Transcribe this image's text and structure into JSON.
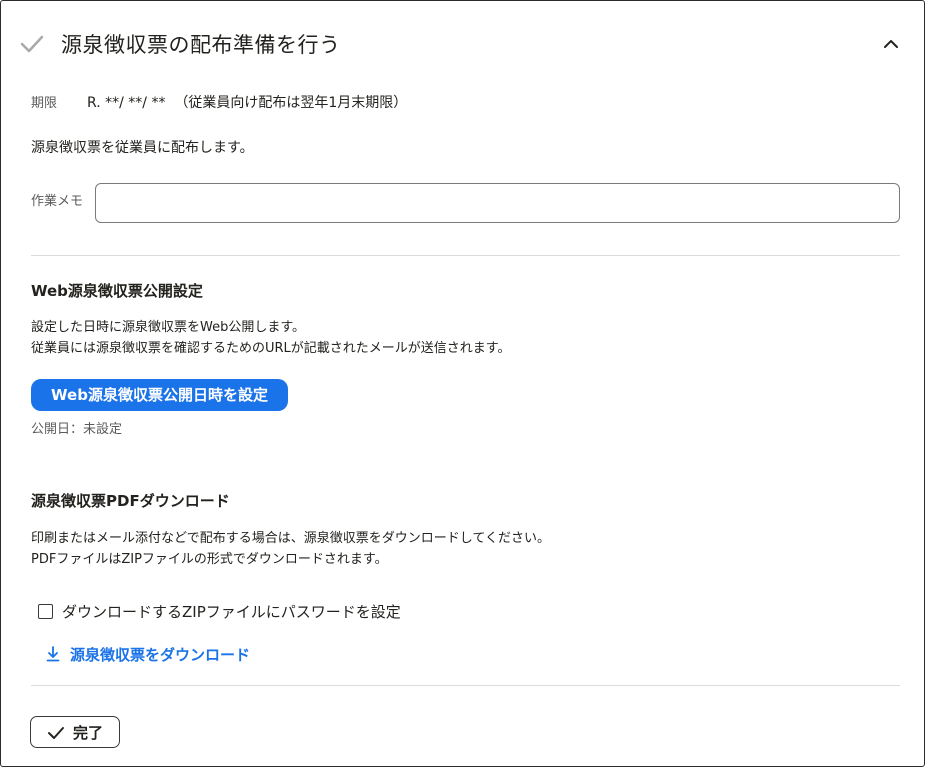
{
  "header": {
    "title": "源泉徴収票の配布準備を行う",
    "status_icon": "check-icon",
    "collapse_icon": "chevron-up-icon"
  },
  "deadline": {
    "label": "期限",
    "value": "R. **/ **/ **  （従業員向け配布は翌年1月末期限）"
  },
  "description": "源泉徴収票を従業員に配布します。",
  "memo": {
    "label": "作業メモ",
    "value": "",
    "placeholder": ""
  },
  "web_section": {
    "title": "Web源泉徴収票公開設定",
    "lines": [
      "設定した日時に源泉徴収票をWeb公開します。",
      "従業員には源泉徴収票を確認するためのURLが記載されたメールが送信されます。"
    ],
    "button_label": "Web源泉徴収票公開日時を設定",
    "publish_date": "公開日：未設定"
  },
  "pdf_section": {
    "title": "源泉徴収票PDFダウンロード",
    "lines": [
      "印刷またはメール添付などで配布する場合は、源泉徴収票をダウンロードしてください。",
      "PDFファイルはZIPファイルの形式でダウンロードされます。"
    ],
    "password_checkbox_label": "ダウンロードするZIPファイルにパスワードを設定",
    "password_checked": false,
    "download_label": "源泉徴収票をダウンロード",
    "download_icon": "download-icon"
  },
  "footer": {
    "done_label": "完了",
    "done_icon": "check-icon"
  },
  "colors": {
    "accent": "#1a73e8",
    "text": "#23221e",
    "muted": "#5c5c5c",
    "check_gray": "#a9a9a9"
  }
}
